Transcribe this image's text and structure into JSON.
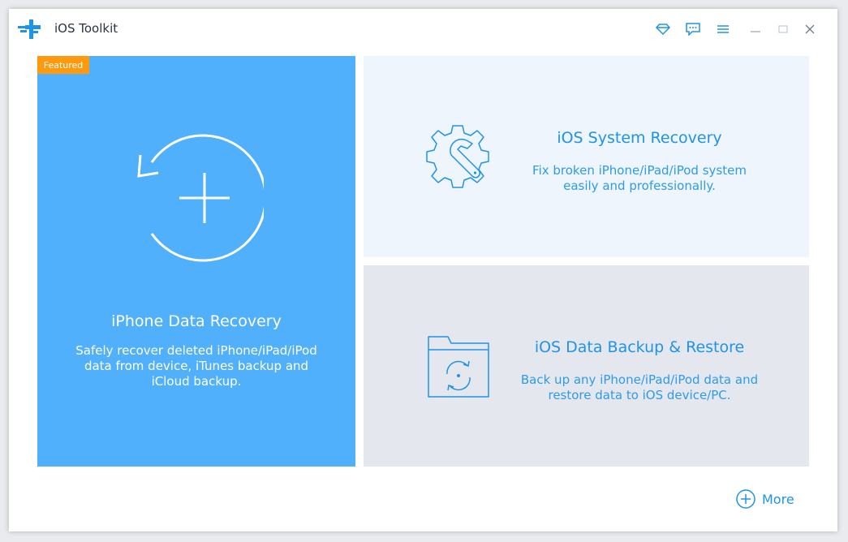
{
  "app": {
    "title": "iOS Toolkit"
  },
  "titlebar": {
    "icons": [
      "diamond-icon",
      "feedback-icon",
      "menu-icon",
      "minimize-icon",
      "maximize-icon",
      "close-icon"
    ]
  },
  "cards": {
    "iphone_data_recovery": {
      "badge": "Featured",
      "title": "iPhone Data Recovery",
      "desc_lines": [
        "Safely recover deleted iPhone/iPad/iPod",
        "data from device, iTunes backup and",
        "iCloud backup."
      ]
    },
    "ios_system_recovery": {
      "title": "iOS System Recovery",
      "desc_lines": [
        "Fix broken iPhone/iPad/iPod system",
        "easily and professionally."
      ]
    },
    "ios_data_backup": {
      "title": "iOS Data Backup & Restore",
      "desc_lines": [
        "Back up any iPhone/iPad/iPod data and",
        "restore data to iOS device/PC."
      ]
    }
  },
  "more": {
    "label": "More"
  },
  "colors": {
    "accent": "#1f93e8",
    "featured_card": "#51b0fb",
    "badge": "#ff9a0f",
    "system_card": "#eef5fd",
    "backup_card": "#e4e8ee"
  }
}
